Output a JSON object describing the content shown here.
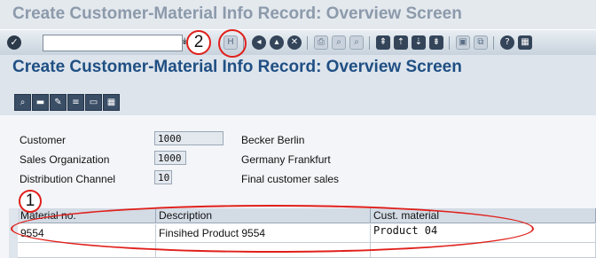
{
  "window_title": "Create Customer-Material Info Record: Overview Screen",
  "screen_title": "Create Customer-Material Info Record: Overview Screen",
  "toolbar": {
    "ok_icon": "checkmark-icon",
    "command_field_value": "",
    "command_arrow": "↡",
    "save_glyph": "H",
    "nav_glyphs": [
      "◂",
      "▴",
      "✕"
    ],
    "print_glyphs": [
      "⎙",
      "⌕",
      "⌕"
    ],
    "page_glyphs": [
      "⇞",
      "⇡",
      "⇣",
      "⇟"
    ],
    "session_glyphs": [
      "▣",
      "⧉"
    ],
    "help_glyphs": [
      "?",
      "▦"
    ]
  },
  "app_toolbar": {
    "glyphs": [
      "⌕",
      "▬",
      "✎",
      "≡",
      "▭",
      "▦"
    ]
  },
  "header_fields": [
    {
      "label": "Customer",
      "value": "1000",
      "description": "Becker Berlin"
    },
    {
      "label": "Sales Organization",
      "value": "1000",
      "description": "Germany Frankfurt"
    },
    {
      "label": "Distribution Channel",
      "value": "10",
      "description": "Final customer sales"
    }
  ],
  "table": {
    "columns": [
      "Material no.",
      "Description",
      "Cust. material"
    ],
    "rows": [
      [
        "9554",
        "Finsihed Product 9554",
        "Product 04"
      ]
    ]
  },
  "callouts": [
    "1",
    "2"
  ]
}
